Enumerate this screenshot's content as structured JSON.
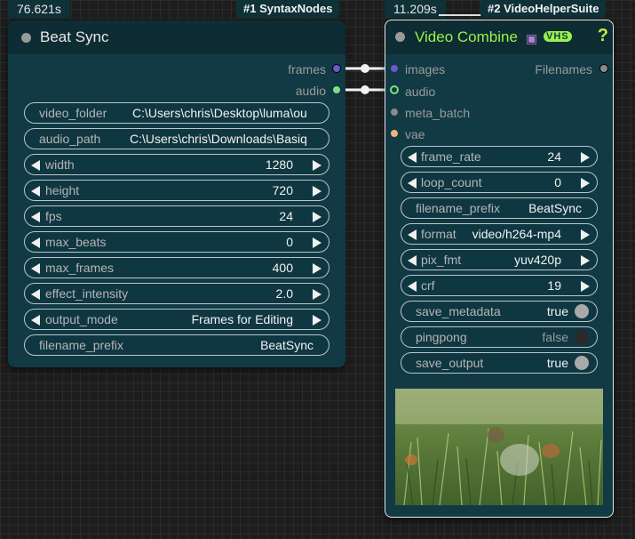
{
  "node1": {
    "time": "76.621s",
    "pack": "#1 SyntaxNodes",
    "title": "Beat Sync",
    "outputs": [
      {
        "label": "frames",
        "color": "#6a5acd"
      },
      {
        "label": "audio",
        "color": "#80e080"
      }
    ],
    "widgets": [
      {
        "name": "video_folder",
        "value": "C:\\Users\\chris\\Desktop\\luma\\ou",
        "type": "text"
      },
      {
        "name": "audio_path",
        "value": "C:\\Users\\chris\\Downloads\\Basiq",
        "type": "text"
      },
      {
        "name": "width",
        "value": "1280",
        "type": "number"
      },
      {
        "name": "height",
        "value": "720",
        "type": "number"
      },
      {
        "name": "fps",
        "value": "24",
        "type": "number"
      },
      {
        "name": "max_beats",
        "value": "0",
        "type": "number"
      },
      {
        "name": "max_frames",
        "value": "400",
        "type": "number"
      },
      {
        "name": "effect_intensity",
        "value": "2.0",
        "type": "number"
      },
      {
        "name": "output_mode",
        "value": "Frames for Editing",
        "type": "combo"
      },
      {
        "name": "filename_prefix",
        "value": "BeatSync",
        "type": "text"
      }
    ]
  },
  "node2": {
    "time": "11.209s",
    "pack": "#2 VideoHelperSuite",
    "title": "Video Combine",
    "title_icon": "movie-camera-icon",
    "vhs_badge": "VHS",
    "help": "?",
    "inputs": [
      {
        "label": "images",
        "color": "#6a5acd"
      },
      {
        "label": "audio",
        "color": "#80e080"
      },
      {
        "label": "meta_batch",
        "color": "#8a8a8a"
      },
      {
        "label": "vae",
        "color": "#f0b27a"
      }
    ],
    "output": {
      "label": "Filenames",
      "color": "#8a8a8a"
    },
    "widgets": [
      {
        "name": "frame_rate",
        "value": "24",
        "type": "number"
      },
      {
        "name": "loop_count",
        "value": "0",
        "type": "number"
      },
      {
        "name": "filename_prefix",
        "value": "BeatSync",
        "type": "text"
      },
      {
        "name": "format",
        "value": "video/h264-mp4",
        "type": "combo"
      },
      {
        "name": "pix_fmt",
        "value": "yuv420p",
        "type": "combo"
      },
      {
        "name": "crf",
        "value": "19",
        "type": "number"
      },
      {
        "name": "save_metadata",
        "value": "true",
        "type": "toggle",
        "on": true
      },
      {
        "name": "pingpong",
        "value": "false",
        "type": "toggle",
        "on": false
      },
      {
        "name": "save_output",
        "value": "true",
        "type": "toggle",
        "on": true
      }
    ],
    "preview": "video-preview-thumbnail"
  }
}
